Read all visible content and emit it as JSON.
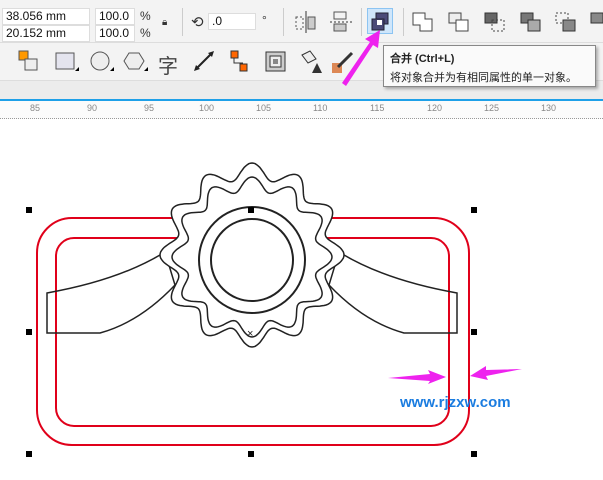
{
  "props": {
    "width": "38.056 mm",
    "height": "20.152 mm",
    "scale_x": "100.0",
    "scale_y": "100.0",
    "pct": "%",
    "angle": ".0",
    "deg": "°"
  },
  "tooltip": {
    "title": "合并 (Ctrl+L)",
    "desc": "将对象合并为有相同属性的单一对象。"
  },
  "toolbar2": {
    "text_tool": "字"
  },
  "ruler": [
    "85",
    "90",
    "95",
    "100",
    "105",
    "110",
    "115",
    "120",
    "125",
    "130"
  ],
  "watermark": "www.rjzxw.com",
  "colors": {
    "accent": "#1ea0e8",
    "outline": "#e0001a",
    "arrow": "#ee22ee",
    "watermark": "#1a7ce0"
  }
}
